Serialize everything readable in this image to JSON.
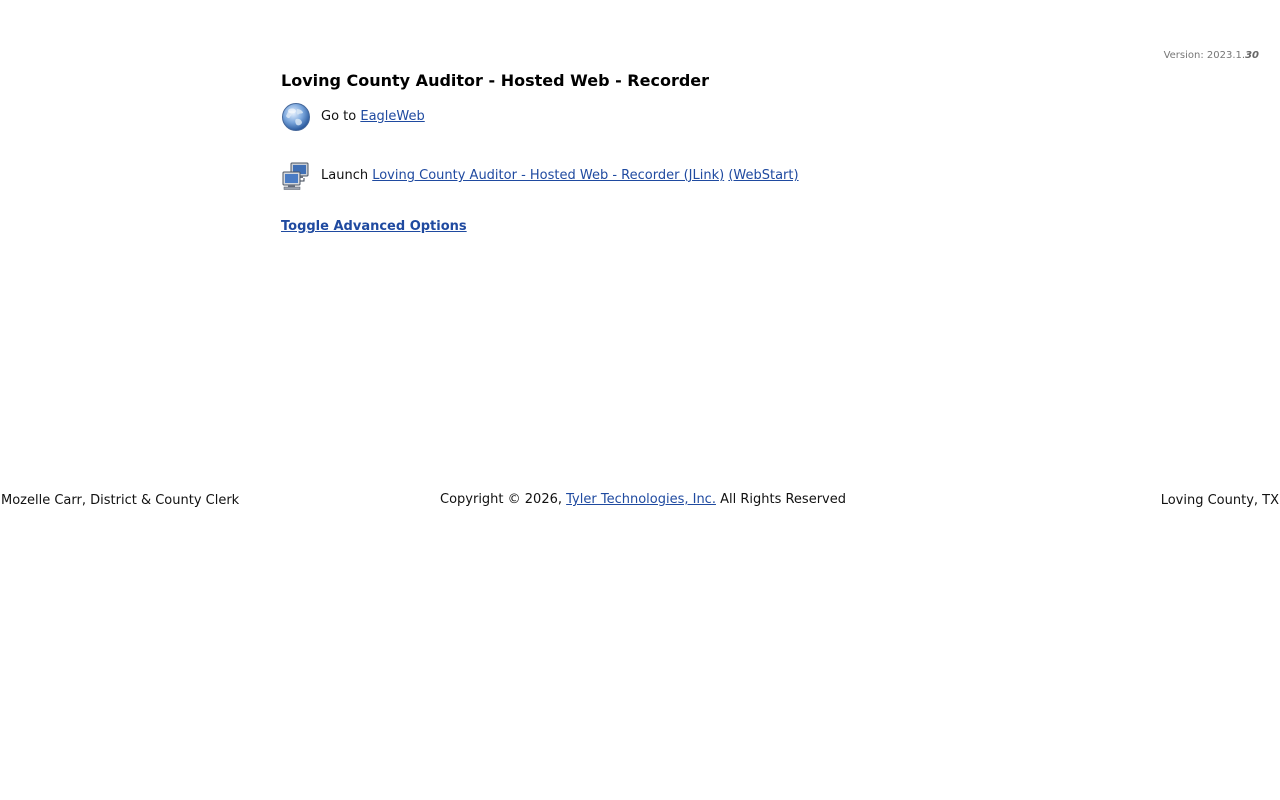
{
  "version": {
    "prefix": "Version: 2023.1.",
    "build": "30"
  },
  "title": "Loving County Auditor - Hosted Web - Recorder",
  "eagleweb": {
    "icon": "globe-icon",
    "prefix": "Go to ",
    "link_label": "EagleWeb"
  },
  "launch": {
    "icon": "network-computers-icon",
    "prefix": "Launch ",
    "jlink_label": "Loving County Auditor - Hosted Web - Recorder (JLink)",
    "webstart_label": "(WebStart)"
  },
  "toggle_label": "Toggle Advanced Options",
  "footer": {
    "left": "Mozelle Carr, District & County Clerk",
    "copyright_prefix": "Copyright © 2026, ",
    "company_link": "Tyler Technologies, Inc.",
    "copyright_suffix": " All Rights Reserved",
    "right": "Loving County, TX"
  },
  "colors": {
    "link": "#1f4aa0",
    "text": "#111111",
    "version_text": "#777777"
  }
}
